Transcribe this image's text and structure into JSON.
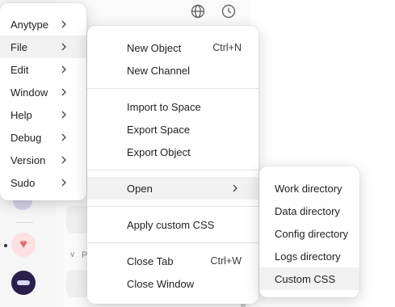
{
  "main_menu": {
    "items": [
      {
        "label": "Anytype"
      },
      {
        "label": "File"
      },
      {
        "label": "Edit"
      },
      {
        "label": "Window"
      },
      {
        "label": "Help"
      },
      {
        "label": "Debug"
      },
      {
        "label": "Version"
      },
      {
        "label": "Sudo"
      }
    ]
  },
  "file_menu": {
    "new_object": "New Object",
    "new_object_shortcut": "Ctrl+N",
    "new_channel": "New Channel",
    "import_to_space": "Import to Space",
    "export_space": "Export Space",
    "export_object": "Export Object",
    "open": "Open",
    "apply_custom_css": "Apply custom CSS",
    "close_tab": "Close Tab",
    "close_tab_shortcut": "Ctrl+W",
    "close_window": "Close Window"
  },
  "open_menu": {
    "items": [
      {
        "label": "Work directory"
      },
      {
        "label": "Data directory"
      },
      {
        "label": "Config directory"
      },
      {
        "label": "Logs directory"
      },
      {
        "label": "Custom CSS"
      }
    ]
  },
  "background": {
    "section_letter": "P"
  }
}
